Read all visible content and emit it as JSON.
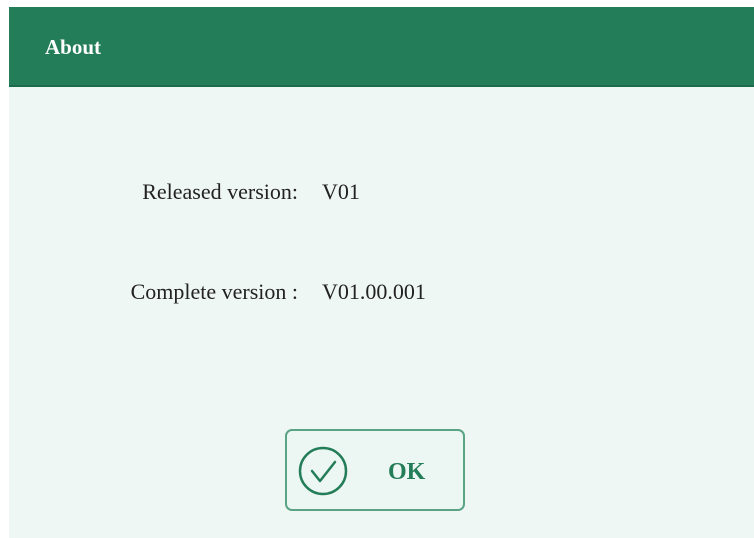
{
  "dialog": {
    "title": "About",
    "rows": [
      {
        "label": "Released version:",
        "value": "V01"
      },
      {
        "label": "Complete version :",
        "value": "V01.00.001"
      }
    ],
    "ok_button": {
      "label": "OK",
      "icon": "check-circle-icon"
    }
  },
  "colors": {
    "titlebar": "#237d59",
    "background": "#eff7f5",
    "accent": "#237d59",
    "button_border": "#5aa485"
  }
}
